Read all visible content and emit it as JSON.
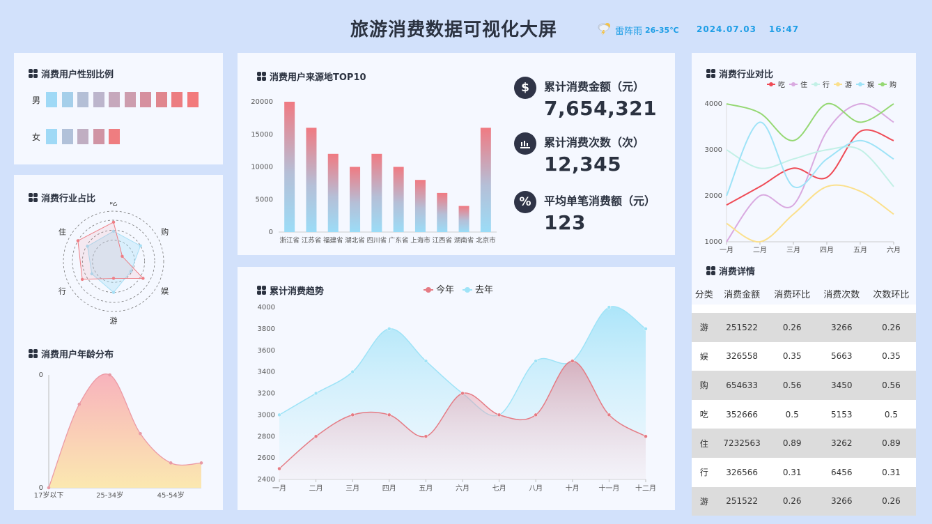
{
  "header": {
    "title": "旅游消费数据可视化大屏",
    "weather": "雷阵雨",
    "temperature": "26-35℃",
    "date": "2024.07.03",
    "time": "16:47"
  },
  "panels": {
    "gender_title": "消费用户性别比例",
    "industry_share_title": "消费行业占比",
    "age_title": "消费用户年龄分布",
    "source_title": "消费用户来源地TOP10",
    "trend_title": "累计消费趋势",
    "compare_title": "消费行业对比",
    "detail_title": "消费详情"
  },
  "gender": {
    "male_label": "男",
    "female_label": "女",
    "male_blocks": [
      "#9fd9f6",
      "#a5cfea",
      "#b4bfd6",
      "#bcb5cc",
      "#c6a8bc",
      "#cd9dae",
      "#d6909f",
      "#e0868e",
      "#ec7d81",
      "#f27a7c"
    ],
    "female_blocks": [
      "#9fd9f6",
      "#b1c1d9",
      "#c0aec2",
      "#d094a4",
      "#ef7d80"
    ]
  },
  "stats": [
    {
      "icon": "$",
      "label": "累计消费金额（元）",
      "value": "7,654,321"
    },
    {
      "icon": "▥",
      "label": "累计消费次数（次）",
      "value": "12,345"
    },
    {
      "icon": "%",
      "label": "平均单笔消费额（元）",
      "value": "123"
    }
  ],
  "chart_data": [
    {
      "id": "source_top10",
      "type": "bar",
      "categories": [
        "浙江省",
        "江苏省",
        "福建省",
        "湖北省",
        "四川省",
        "广东省",
        "上海市",
        "江西省",
        "湖南省",
        "北京市"
      ],
      "values": [
        20000,
        16000,
        12000,
        10000,
        12000,
        10000,
        8000,
        6000,
        4000,
        16000
      ],
      "ylim": [
        0,
        20000
      ],
      "yticks": [
        0,
        5000,
        10000,
        15000,
        20000
      ],
      "grid": false
    },
    {
      "id": "trend",
      "type": "area",
      "categories": [
        "一月",
        "二月",
        "三月",
        "四月",
        "五月",
        "六月",
        "七月",
        "八月",
        "十月",
        "十一月",
        "十二月"
      ],
      "series": [
        {
          "name": "今年",
          "values": [
            2500,
            2800,
            3000,
            3000,
            2800,
            3200,
            3000,
            3000,
            3500,
            3000,
            2800
          ],
          "color": "#e57b84"
        },
        {
          "name": "去年",
          "values": [
            3000,
            3200,
            3400,
            3800,
            3500,
            3200,
            3000,
            3500,
            3500,
            4000,
            3800
          ],
          "color": "#9ee3f7"
        }
      ],
      "ylim": [
        2400,
        4000
      ],
      "yticks": [
        2400,
        2600,
        2800,
        3000,
        3200,
        3400,
        3600,
        3800,
        4000
      ],
      "legend": "top-center"
    },
    {
      "id": "industry_compare",
      "type": "line",
      "categories": [
        "一月",
        "二月",
        "三月",
        "四月",
        "五月",
        "六月"
      ],
      "series": [
        {
          "name": "吃",
          "values": [
            1800,
            2200,
            2600,
            2400,
            3400,
            3200
          ],
          "color": "#ef4a55"
        },
        {
          "name": "住",
          "values": [
            1000,
            2000,
            1800,
            3400,
            4000,
            3600
          ],
          "color": "#d9a9e0"
        },
        {
          "name": "行",
          "values": [
            3000,
            2600,
            2800,
            3000,
            3000,
            2200
          ],
          "color": "#c2f0e6"
        },
        {
          "name": "游",
          "values": [
            1400,
            1000,
            1600,
            2200,
            2100,
            1600
          ],
          "color": "#fbe08c"
        },
        {
          "name": "娱",
          "values": [
            2000,
            3600,
            2200,
            2800,
            3200,
            2800
          ],
          "color": "#9ee3f7"
        },
        {
          "name": "购",
          "values": [
            4000,
            3800,
            3200,
            4000,
            3600,
            4000
          ],
          "color": "#95d873"
        }
      ],
      "ylim": [
        1000,
        4000
      ],
      "yticks": [
        1000,
        2000,
        3000,
        4000
      ],
      "legend": "top"
    },
    {
      "id": "industry_share",
      "type": "radar",
      "indicators": [
        "吃",
        "购",
        "娱",
        "游",
        "行",
        "住"
      ],
      "series": [
        {
          "values": [
            0.78,
            0.2,
            0.68,
            0.34,
            0.72,
            0.82
          ],
          "color": "#ee7d84"
        },
        {
          "values": [
            0.6,
            0.62,
            0.4,
            0.62,
            0.5,
            0.6
          ],
          "color": "#a7dff5"
        }
      ]
    },
    {
      "id": "age_distribution",
      "type": "area",
      "categories": [
        "17岁以下",
        "",
        "25-34岁",
        "",
        "45-54岁",
        ""
      ],
      "values": [
        0,
        0.74,
        1.0,
        0.48,
        0.22,
        0.22
      ],
      "yticks": [
        "0",
        "0"
      ],
      "xticklabels": [
        "17岁以下",
        "25-34岁",
        "45-54岁"
      ]
    }
  ],
  "detail_table": {
    "headers": [
      "分类",
      "消费金额",
      "消费环比",
      "消费次数",
      "次数环比"
    ],
    "rows": [
      [
        "游",
        "251522",
        "0.26",
        "3266",
        "0.26"
      ],
      [
        "娱",
        "326558",
        "0.35",
        "5663",
        "0.35"
      ],
      [
        "购",
        "654633",
        "0.56",
        "3450",
        "0.56"
      ],
      [
        "吃",
        "352666",
        "0.5",
        "5153",
        "0.5"
      ],
      [
        "住",
        "7232563",
        "0.89",
        "3262",
        "0.89"
      ],
      [
        "行",
        "326566",
        "0.31",
        "6456",
        "0.31"
      ],
      [
        "游",
        "251522",
        "0.26",
        "3266",
        "0.26"
      ]
    ]
  }
}
